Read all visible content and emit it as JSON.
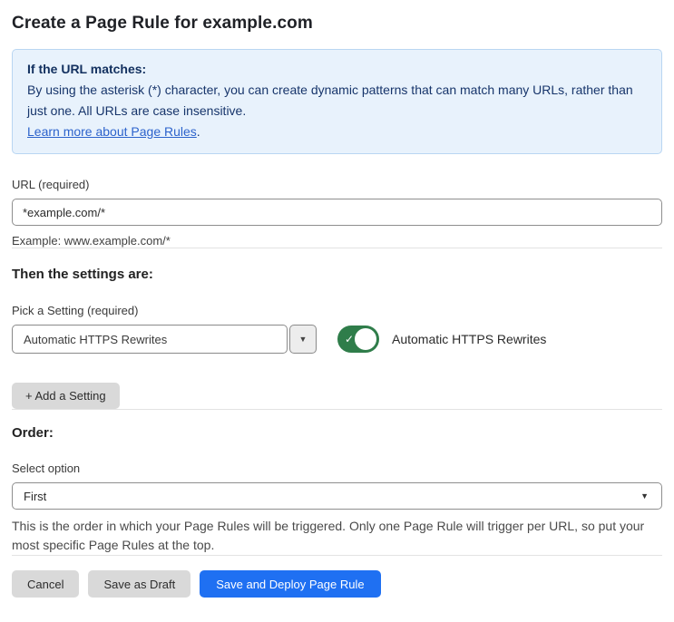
{
  "page": {
    "title": "Create a Page Rule for example.com"
  },
  "info_box": {
    "heading": "If the URL matches:",
    "body": "By using the asterisk (*) character, you can create dynamic patterns that can match many URLs, rather than just one. All URLs are case insensitive.",
    "link_label": "Learn more about Page Rules",
    "link_suffix": "."
  },
  "url_field": {
    "label": "URL (required)",
    "value": "*example.com/*",
    "helper": "Example: www.example.com/*"
  },
  "settings_section": {
    "heading": "Then the settings are:",
    "picker_label": "Pick a Setting (required)",
    "picker_value": "Automatic HTTPS Rewrites",
    "toggle_state": "on",
    "toggle_label": "Automatic HTTPS Rewrites",
    "add_setting_button": "+ Add a Setting"
  },
  "order_section": {
    "heading": "Order:",
    "select_label": "Select option",
    "select_value": "First",
    "helper": "This is the order in which your Page Rules will be triggered. Only one Page Rule will trigger per URL, so put your most specific Page Rules at the top."
  },
  "footer": {
    "cancel_label": "Cancel",
    "save_draft_label": "Save as Draft",
    "save_deploy_label": "Save and Deploy Page Rule"
  },
  "colors": {
    "info_bg": "#e8f2fc",
    "info_border": "#b9d6f2",
    "info_text": "#17356b",
    "link_blue": "#2c63cc",
    "toggle_green": "#2f7d4a",
    "primary_blue": "#1f70f2",
    "button_gray": "#d9d9d9"
  }
}
